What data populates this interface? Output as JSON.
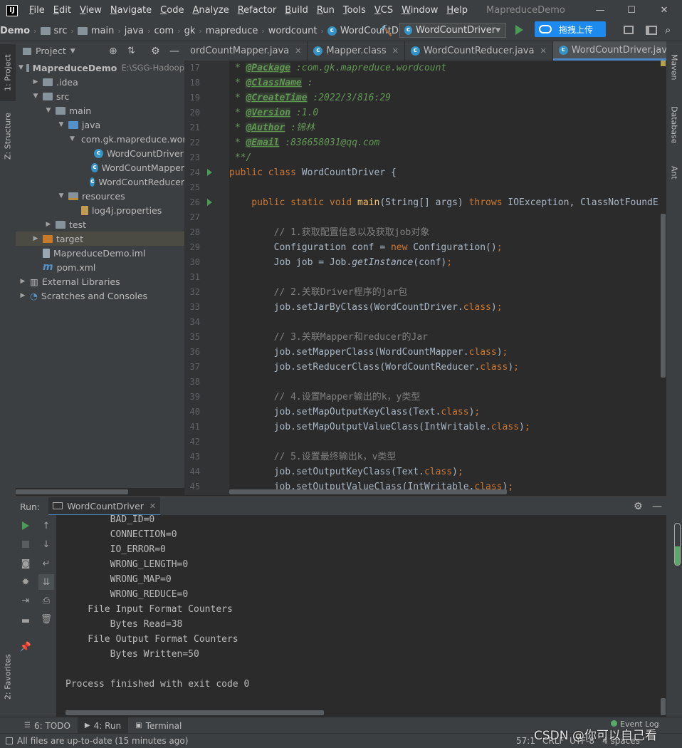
{
  "titlebar": {
    "app_icon": "IJ",
    "menu": [
      "File",
      "Edit",
      "View",
      "Navigate",
      "Code",
      "Analyze",
      "Refactor",
      "Build",
      "Run",
      "Tools",
      "VCS",
      "Window",
      "Help"
    ],
    "title": "MapreduceDemo",
    "minimize_icon": "—",
    "maximize_icon": "☐",
    "close_icon": "✕"
  },
  "navbar": {
    "crumbs": [
      "Demo",
      "src",
      "main",
      "java",
      "com",
      "gk",
      "mapreduce",
      "wordcount"
    ],
    "current_file": "WordCountDriver",
    "run_config": "WordCountDriver",
    "upload_label": "拖拽上传"
  },
  "left_stripe": {
    "project_tab": "1: Project",
    "structure_tab": "Z: Structure",
    "favorites_tab": "2: Favorites"
  },
  "project_panel": {
    "title": "Project",
    "tree": [
      {
        "label": "MapreduceDemo",
        "suffix": "E:\\SGG-Hadoop",
        "level": 0,
        "arrow": "▼",
        "icon": "folder",
        "bold": true
      },
      {
        "label": ".idea",
        "level": 1,
        "arrow": "▶",
        "icon": "folder"
      },
      {
        "label": "src",
        "level": 1,
        "arrow": "▼",
        "icon": "folder"
      },
      {
        "label": "main",
        "level": 2,
        "arrow": "▼",
        "icon": "folder"
      },
      {
        "label": "java",
        "level": 3,
        "arrow": "▼",
        "icon": "folder-blue"
      },
      {
        "label": "com.gk.mapreduce.wordcount",
        "level": 4,
        "arrow": "▼",
        "icon": "package"
      },
      {
        "label": "WordCountDriver",
        "level": 5,
        "arrow": "",
        "icon": "class"
      },
      {
        "label": "WordCountMapper",
        "level": 5,
        "arrow": "",
        "icon": "class"
      },
      {
        "label": "WordCountReducer",
        "level": 5,
        "arrow": "",
        "icon": "class"
      },
      {
        "label": "resources",
        "level": 3,
        "arrow": "▼",
        "icon": "folder-res"
      },
      {
        "label": "log4j.properties",
        "level": 4,
        "arrow": "",
        "icon": "props"
      },
      {
        "label": "test",
        "level": 2,
        "arrow": "▶",
        "icon": "folder"
      },
      {
        "label": "target",
        "level": 1,
        "arrow": "▶",
        "icon": "folder-orange",
        "selected": true
      },
      {
        "label": "MapreduceDemo.iml",
        "level": 1,
        "arrow": "",
        "icon": "iml"
      },
      {
        "label": "pom.xml",
        "level": 1,
        "arrow": "",
        "icon": "maven"
      },
      {
        "label": "External Libraries",
        "level": 0,
        "arrow": "▶",
        "icon": "libs"
      },
      {
        "label": "Scratches and Consoles",
        "level": 0,
        "arrow": "▶",
        "icon": "scratch"
      }
    ]
  },
  "editor_tabs": [
    {
      "label": "ordCountMapper.java",
      "active": false,
      "icon": "none"
    },
    {
      "label": "Mapper.class",
      "active": false,
      "icon": "class"
    },
    {
      "label": "WordCountReducer.java",
      "active": false,
      "icon": "class"
    },
    {
      "label": "WordCountDriver.java",
      "active": true,
      "icon": "class"
    }
  ],
  "editor": {
    "line_numbers": [
      "17",
      "18",
      "19",
      "20",
      "21",
      "22",
      "23",
      "24",
      "25",
      "26",
      "27",
      "28",
      "29",
      "30",
      "31",
      "32",
      "33",
      "34",
      "35",
      "36",
      "37",
      "38",
      "39",
      "40",
      "41",
      "42",
      "43",
      "44",
      "45"
    ],
    "run_marker_lines": [
      "24",
      "26"
    ],
    "lines": [
      [
        {
          "t": " * ",
          "c": "doc"
        },
        {
          "t": "@Package",
          "c": "tag"
        },
        {
          "t": " :com.gk.mapreduce.wordcount",
          "c": "doc"
        }
      ],
      [
        {
          "t": " * ",
          "c": "doc"
        },
        {
          "t": "@ClassName",
          "c": "tag"
        },
        {
          "t": " :",
          "c": "doc"
        }
      ],
      [
        {
          "t": " * ",
          "c": "doc"
        },
        {
          "t": "@CreateTime",
          "c": "tag"
        },
        {
          "t": " :2022/3/816:29",
          "c": "doc"
        }
      ],
      [
        {
          "t": " * ",
          "c": "doc"
        },
        {
          "t": "@Version",
          "c": "tag"
        },
        {
          "t": " :1.0",
          "c": "doc"
        }
      ],
      [
        {
          "t": " * ",
          "c": "doc"
        },
        {
          "t": "@Author",
          "c": "tag"
        },
        {
          "t": " :锦林",
          "c": "doc"
        }
      ],
      [
        {
          "t": " * ",
          "c": "doc"
        },
        {
          "t": "@Email",
          "c": "tag"
        },
        {
          "t": " :836658031@qq.com",
          "c": "doc"
        }
      ],
      [
        {
          "t": " **/",
          "c": "doc"
        }
      ],
      [
        {
          "t": "public class ",
          "c": "kw"
        },
        {
          "t": "WordCountDriver {",
          "c": ""
        }
      ],
      [],
      [
        {
          "t": "    public static void ",
          "c": "kw"
        },
        {
          "t": "main",
          "c": "fn"
        },
        {
          "t": "(String[] args) ",
          "c": ""
        },
        {
          "t": "throws ",
          "c": "kw"
        },
        {
          "t": "IOException, ClassNotFoundException",
          "c": ""
        }
      ],
      [],
      [
        {
          "t": "        // 1.获取配置信息以及获取job对象",
          "c": "cm"
        }
      ],
      [
        {
          "t": "        Configuration conf = ",
          "c": ""
        },
        {
          "t": "new ",
          "c": "kw"
        },
        {
          "t": "Configuration()",
          "c": ""
        },
        {
          "t": ";",
          "c": "kw"
        }
      ],
      [
        {
          "t": "        Job job = Job.",
          "c": ""
        },
        {
          "t": "getInstance",
          "c": "it"
        },
        {
          "t": "(conf)",
          "c": ""
        },
        {
          "t": ";",
          "c": "kw"
        }
      ],
      [],
      [
        {
          "t": "        // 2.关联Driver程序的jar包",
          "c": "cm"
        }
      ],
      [
        {
          "t": "        job.setJarByClass(WordCountDriver.",
          "c": ""
        },
        {
          "t": "class",
          "c": "kw"
        },
        {
          "t": ")",
          "c": ""
        },
        {
          "t": ";",
          "c": "kw"
        }
      ],
      [],
      [
        {
          "t": "        // 3.关联Mapper和reducer的Jar",
          "c": "cm"
        }
      ],
      [
        {
          "t": "        job.setMapperClass(WordCountMapper.",
          "c": ""
        },
        {
          "t": "class",
          "c": "kw"
        },
        {
          "t": ")",
          "c": ""
        },
        {
          "t": ";",
          "c": "kw"
        }
      ],
      [
        {
          "t": "        job.setReducerClass(WordCountReducer.",
          "c": ""
        },
        {
          "t": "class",
          "c": "kw"
        },
        {
          "t": ")",
          "c": ""
        },
        {
          "t": ";",
          "c": "kw"
        }
      ],
      [],
      [
        {
          "t": "        // 4.设置Mapper输出的k，y类型",
          "c": "cm"
        }
      ],
      [
        {
          "t": "        job.setMapOutputKeyClass(Text.",
          "c": ""
        },
        {
          "t": "class",
          "c": "kw"
        },
        {
          "t": ")",
          "c": ""
        },
        {
          "t": ";",
          "c": "kw"
        }
      ],
      [
        {
          "t": "        job.setMapOutputValueClass(IntWritable.",
          "c": ""
        },
        {
          "t": "class",
          "c": "kw"
        },
        {
          "t": ")",
          "c": ""
        },
        {
          "t": ";",
          "c": "kw"
        }
      ],
      [],
      [
        {
          "t": "        // 5.设置最终输出k，v类型",
          "c": "cm"
        }
      ],
      [
        {
          "t": "        job.setOutputKeyClass(Text.",
          "c": ""
        },
        {
          "t": "class",
          "c": "kw"
        },
        {
          "t": ")",
          "c": ""
        },
        {
          "t": ";",
          "c": "kw"
        }
      ],
      [
        {
          "t": "        job.setOutputValueClass(IntWritable.",
          "c": ""
        },
        {
          "t": "class",
          "c": "kw"
        },
        {
          "t": ")",
          "c": ""
        },
        {
          "t": ";",
          "c": "kw"
        }
      ]
    ]
  },
  "right_stripe": {
    "maven_tab": "Maven",
    "database_tab": "Database",
    "ant_tab": "Ant"
  },
  "run_panel": {
    "label": "Run:",
    "tab": "WordCountDriver",
    "console_lines": [
      "\t\tBAD_ID=0",
      "\t\tCONNECTION=0",
      "\t\tIO_ERROR=0",
      "\t\tWRONG_LENGTH=0",
      "\t\tWRONG_MAP=0",
      "\t\tWRONG_REDUCE=0",
      "\tFile Input Format Counters ",
      "\t\tBytes Read=38",
      "\tFile Output Format Counters ",
      "\t\tBytes Written=50",
      "",
      "Process finished with exit code 0"
    ]
  },
  "bottom_tabs": [
    {
      "label": "6: TODO",
      "icon": "list-icon",
      "active": false
    },
    {
      "label": "4: Run",
      "icon": "run-icon",
      "active": true
    },
    {
      "label": "Terminal",
      "icon": "terminal-icon",
      "active": false
    }
  ],
  "event_log": "Event Log",
  "statusbar": {
    "message": "All files are up-to-date (15 minutes ago)",
    "position": "57:1",
    "line_sep": "CRLF",
    "encoding": "UTF-8",
    "indent": "4 spaces",
    "watermark": "CSDN @你可以自己看"
  }
}
